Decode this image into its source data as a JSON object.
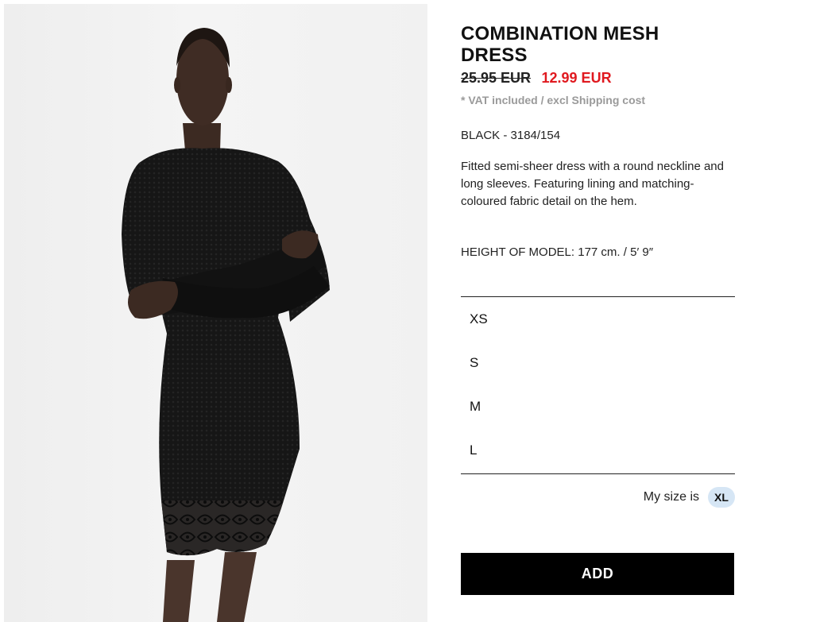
{
  "product": {
    "name": "COMBINATION MESH DRESS",
    "old_price": "25.95 EUR",
    "sale_price": "12.99 EUR",
    "vat_note": "* VAT included / excl Shipping cost",
    "color_ref": "BLACK - 3184/154",
    "description": "Fitted semi-sheer dress with a round neckline and long sleeves. Featuring lining and matching-coloured fabric detail on the hem.",
    "model_height": "HEIGHT OF MODEL: 177 cm. / 5′ 9″"
  },
  "sizes": [
    "XS",
    "S",
    "M",
    "L"
  ],
  "size_advisor": {
    "label": "My size is",
    "value": "XL"
  },
  "actions": {
    "add_label": "ADD"
  },
  "colors": {
    "sale": "#e0191f",
    "badge": "#d6e6f5",
    "button": "#000000"
  }
}
